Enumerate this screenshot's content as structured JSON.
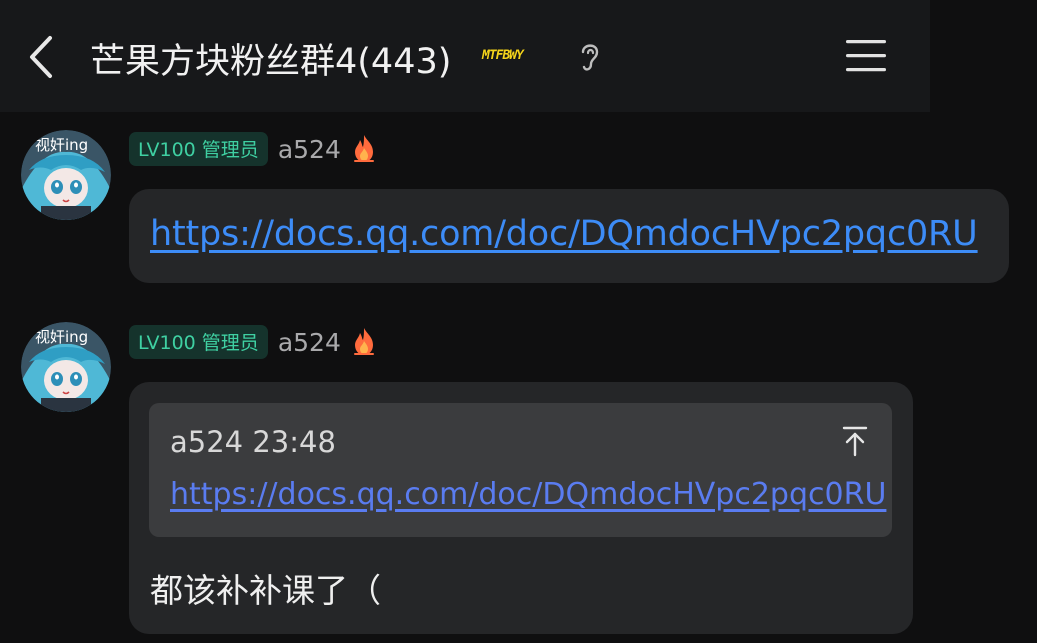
{
  "header": {
    "title": "芒果方块粉丝群4(443)",
    "group_badge": "MTFBWY",
    "icons": {
      "back": "chevron-left-icon",
      "ear": "ear-icon",
      "menu": "hamburger-menu-icon"
    }
  },
  "messages": [
    {
      "avatar": {
        "overlay_text": "视奸ing"
      },
      "role_tag": "LV100 管理员",
      "nickname": "a524",
      "nick_icon": "fire-icon",
      "text_link": "https://docs.qq.com/doc/DQmdocHVpc2pqc0RU"
    },
    {
      "avatar": {
        "overlay_text": "视奸ing"
      },
      "role_tag": "LV100 管理员",
      "nickname": "a524",
      "nick_icon": "fire-icon",
      "quote": {
        "header": "a524 23:48",
        "link": "https://docs.qq.com/doc/DQmdocHVpc2pqc0RU",
        "jump_icon": "arrow-up-to-top-icon"
      },
      "text": "都该补补课了（"
    }
  ],
  "colors": {
    "background": "#0f0f10",
    "header": "#17181a",
    "bubble": "#252628",
    "quote_bg": "#3b3c3e",
    "link": "#3d8cf7",
    "role_tag_text": "#3fd0a2",
    "role_tag_bg": "#15332c",
    "badge": "#f3d31d"
  }
}
